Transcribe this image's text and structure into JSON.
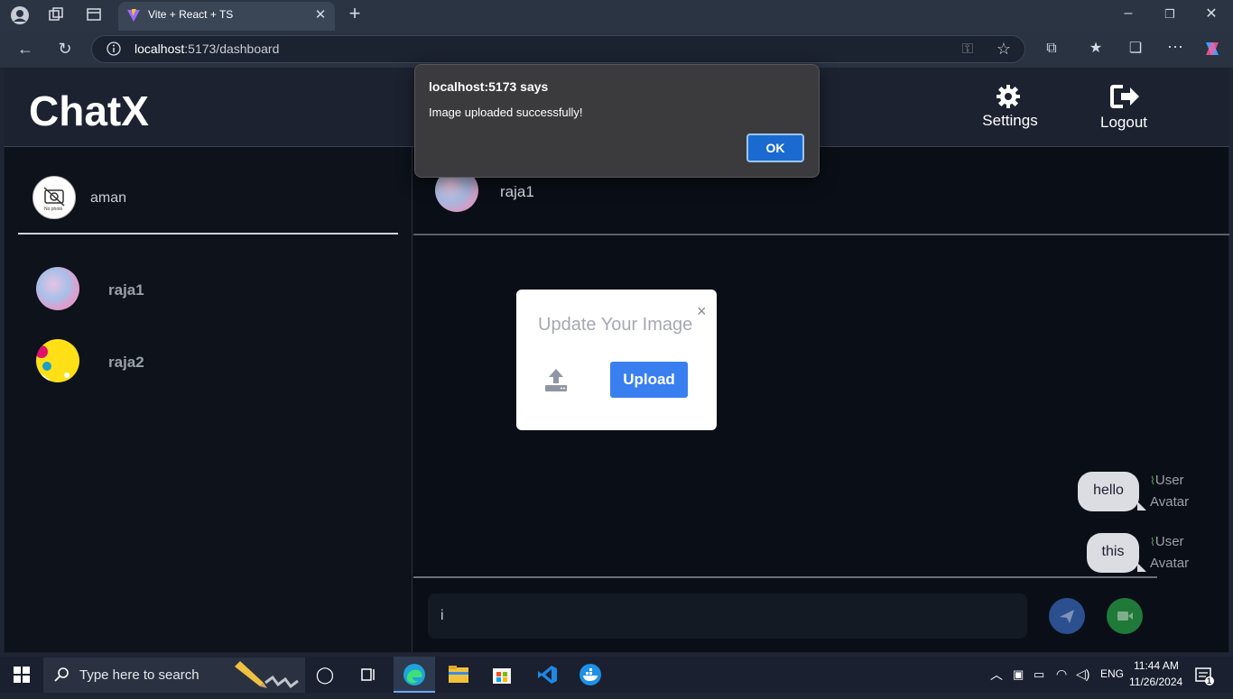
{
  "browser": {
    "tab_title": "Vite + React + TS",
    "url_host": "localhost",
    "url_rest": ":5173/dashboard"
  },
  "app": {
    "logo": "ChatX",
    "header": {
      "settings_label": "Settings",
      "logout_label": "Logout"
    },
    "current_user": {
      "name": "aman",
      "avatar_placeholder": "No photo"
    },
    "contacts": [
      {
        "name": "raja1"
      },
      {
        "name": "raja2"
      }
    ],
    "chat": {
      "recipient": "raja1",
      "messages": [
        {
          "text": "hello",
          "avatar_alt_1": "User",
          "avatar_alt_2": "Avatar"
        },
        {
          "text": "this",
          "avatar_alt_1": "User",
          "avatar_alt_2": "Avatar"
        }
      ],
      "input_value": "i"
    },
    "modal": {
      "title": "Update Your Image",
      "close": "×",
      "upload_label": "Upload"
    }
  },
  "alert": {
    "title": "localhost:5173 says",
    "message": "Image uploaded successfully!",
    "ok_label": "OK"
  },
  "taskbar": {
    "search_placeholder": "Type here to search",
    "lang": "ENG",
    "time": "11:44 AM",
    "date": "11/26/2024",
    "notification_count": "1"
  },
  "colors": {
    "accent_blue": "#3a7ff0",
    "send_button": "#2b4f8f",
    "video_button": "#1f7a3a",
    "app_bg": "#0a0f17"
  }
}
